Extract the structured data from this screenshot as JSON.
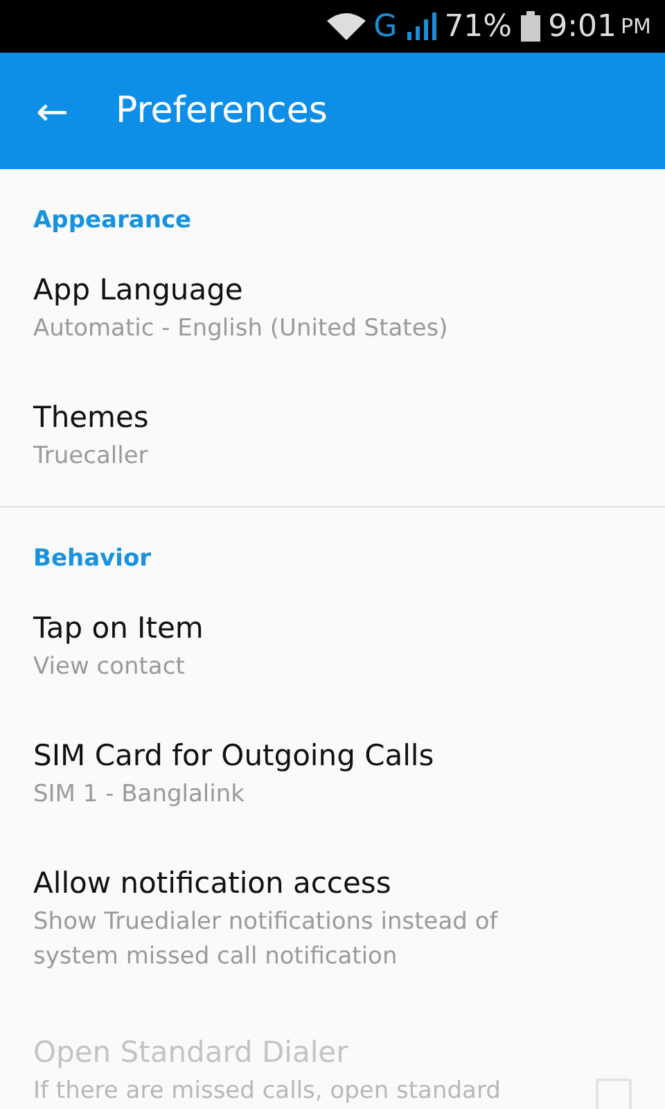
{
  "status_bar": {
    "network": "G",
    "battery": "71%",
    "time": "9:01",
    "ampm": "PM"
  },
  "app_bar": {
    "back": "←",
    "title": "Preferences"
  },
  "sections": [
    {
      "header": "Appearance",
      "divider": true,
      "items": [
        {
          "kind": "plain",
          "title": "App Language",
          "subtitle": "Automatic - English (United States)",
          "disabled": false
        },
        {
          "kind": "plain",
          "title": "Themes",
          "subtitle": "Truecaller",
          "disabled": false
        }
      ]
    },
    {
      "header": "Behavior",
      "items": [
        {
          "kind": "plain",
          "title": "Tap on Item",
          "subtitle": "View contact",
          "disabled": false
        },
        {
          "kind": "plain",
          "title": "SIM Card for Outgoing Calls",
          "subtitle": "SIM 1 - Banglalink",
          "disabled": false
        },
        {
          "kind": "plain",
          "title": "Allow notification access",
          "subtitle": "Show Truedialer notifications instead of system missed call notification",
          "disabled": false
        },
        {
          "kind": "checkbox",
          "title": "Open Standard Dialer",
          "subtitle": "If there are missed calls, open standard",
          "disabled": true,
          "checked": false
        }
      ]
    }
  ]
}
